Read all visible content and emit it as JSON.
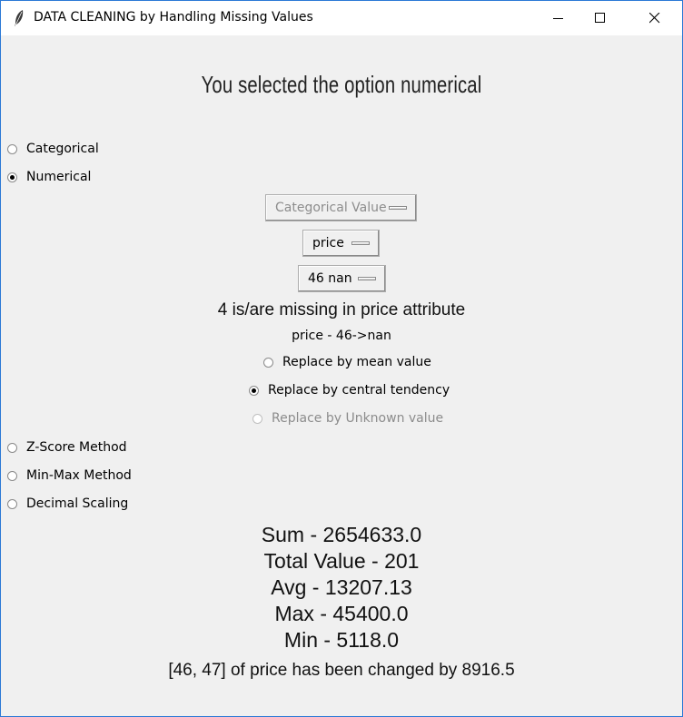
{
  "window": {
    "title": "DATA CLEANING by Handling Missing Values"
  },
  "heading": "You selected the option numerical",
  "type_options": [
    {
      "label": "Categorical",
      "checked": false
    },
    {
      "label": "Numerical",
      "checked": true
    }
  ],
  "dropdowns": {
    "mode": {
      "value": "Categorical Value",
      "disabled": true
    },
    "attribute": {
      "value": "price"
    },
    "row": {
      "value": "46 nan"
    }
  },
  "missing_info": "4 is/are missing in price attribute",
  "selected_cell": "price - 46->nan",
  "replace_options": [
    {
      "label": "Replace by mean value",
      "checked": false,
      "disabled": false
    },
    {
      "label": "Replace by central tendency",
      "checked": true,
      "disabled": false
    },
    {
      "label": "Replace by Unknown value",
      "checked": false,
      "disabled": true
    }
  ],
  "normalization_options": [
    {
      "label": "Z-Score Method",
      "checked": false
    },
    {
      "label": "Min-Max Method",
      "checked": false
    },
    {
      "label": "Decimal Scaling",
      "checked": false
    }
  ],
  "stats": {
    "sum": "Sum - 2654633.0",
    "total": "Total Value - 201",
    "avg": "Avg - 13207.13",
    "max": "Max - 45400.0",
    "min": "Min - 5118.0"
  },
  "change_message": "[46, 47] of price has been changed by 8916.5"
}
